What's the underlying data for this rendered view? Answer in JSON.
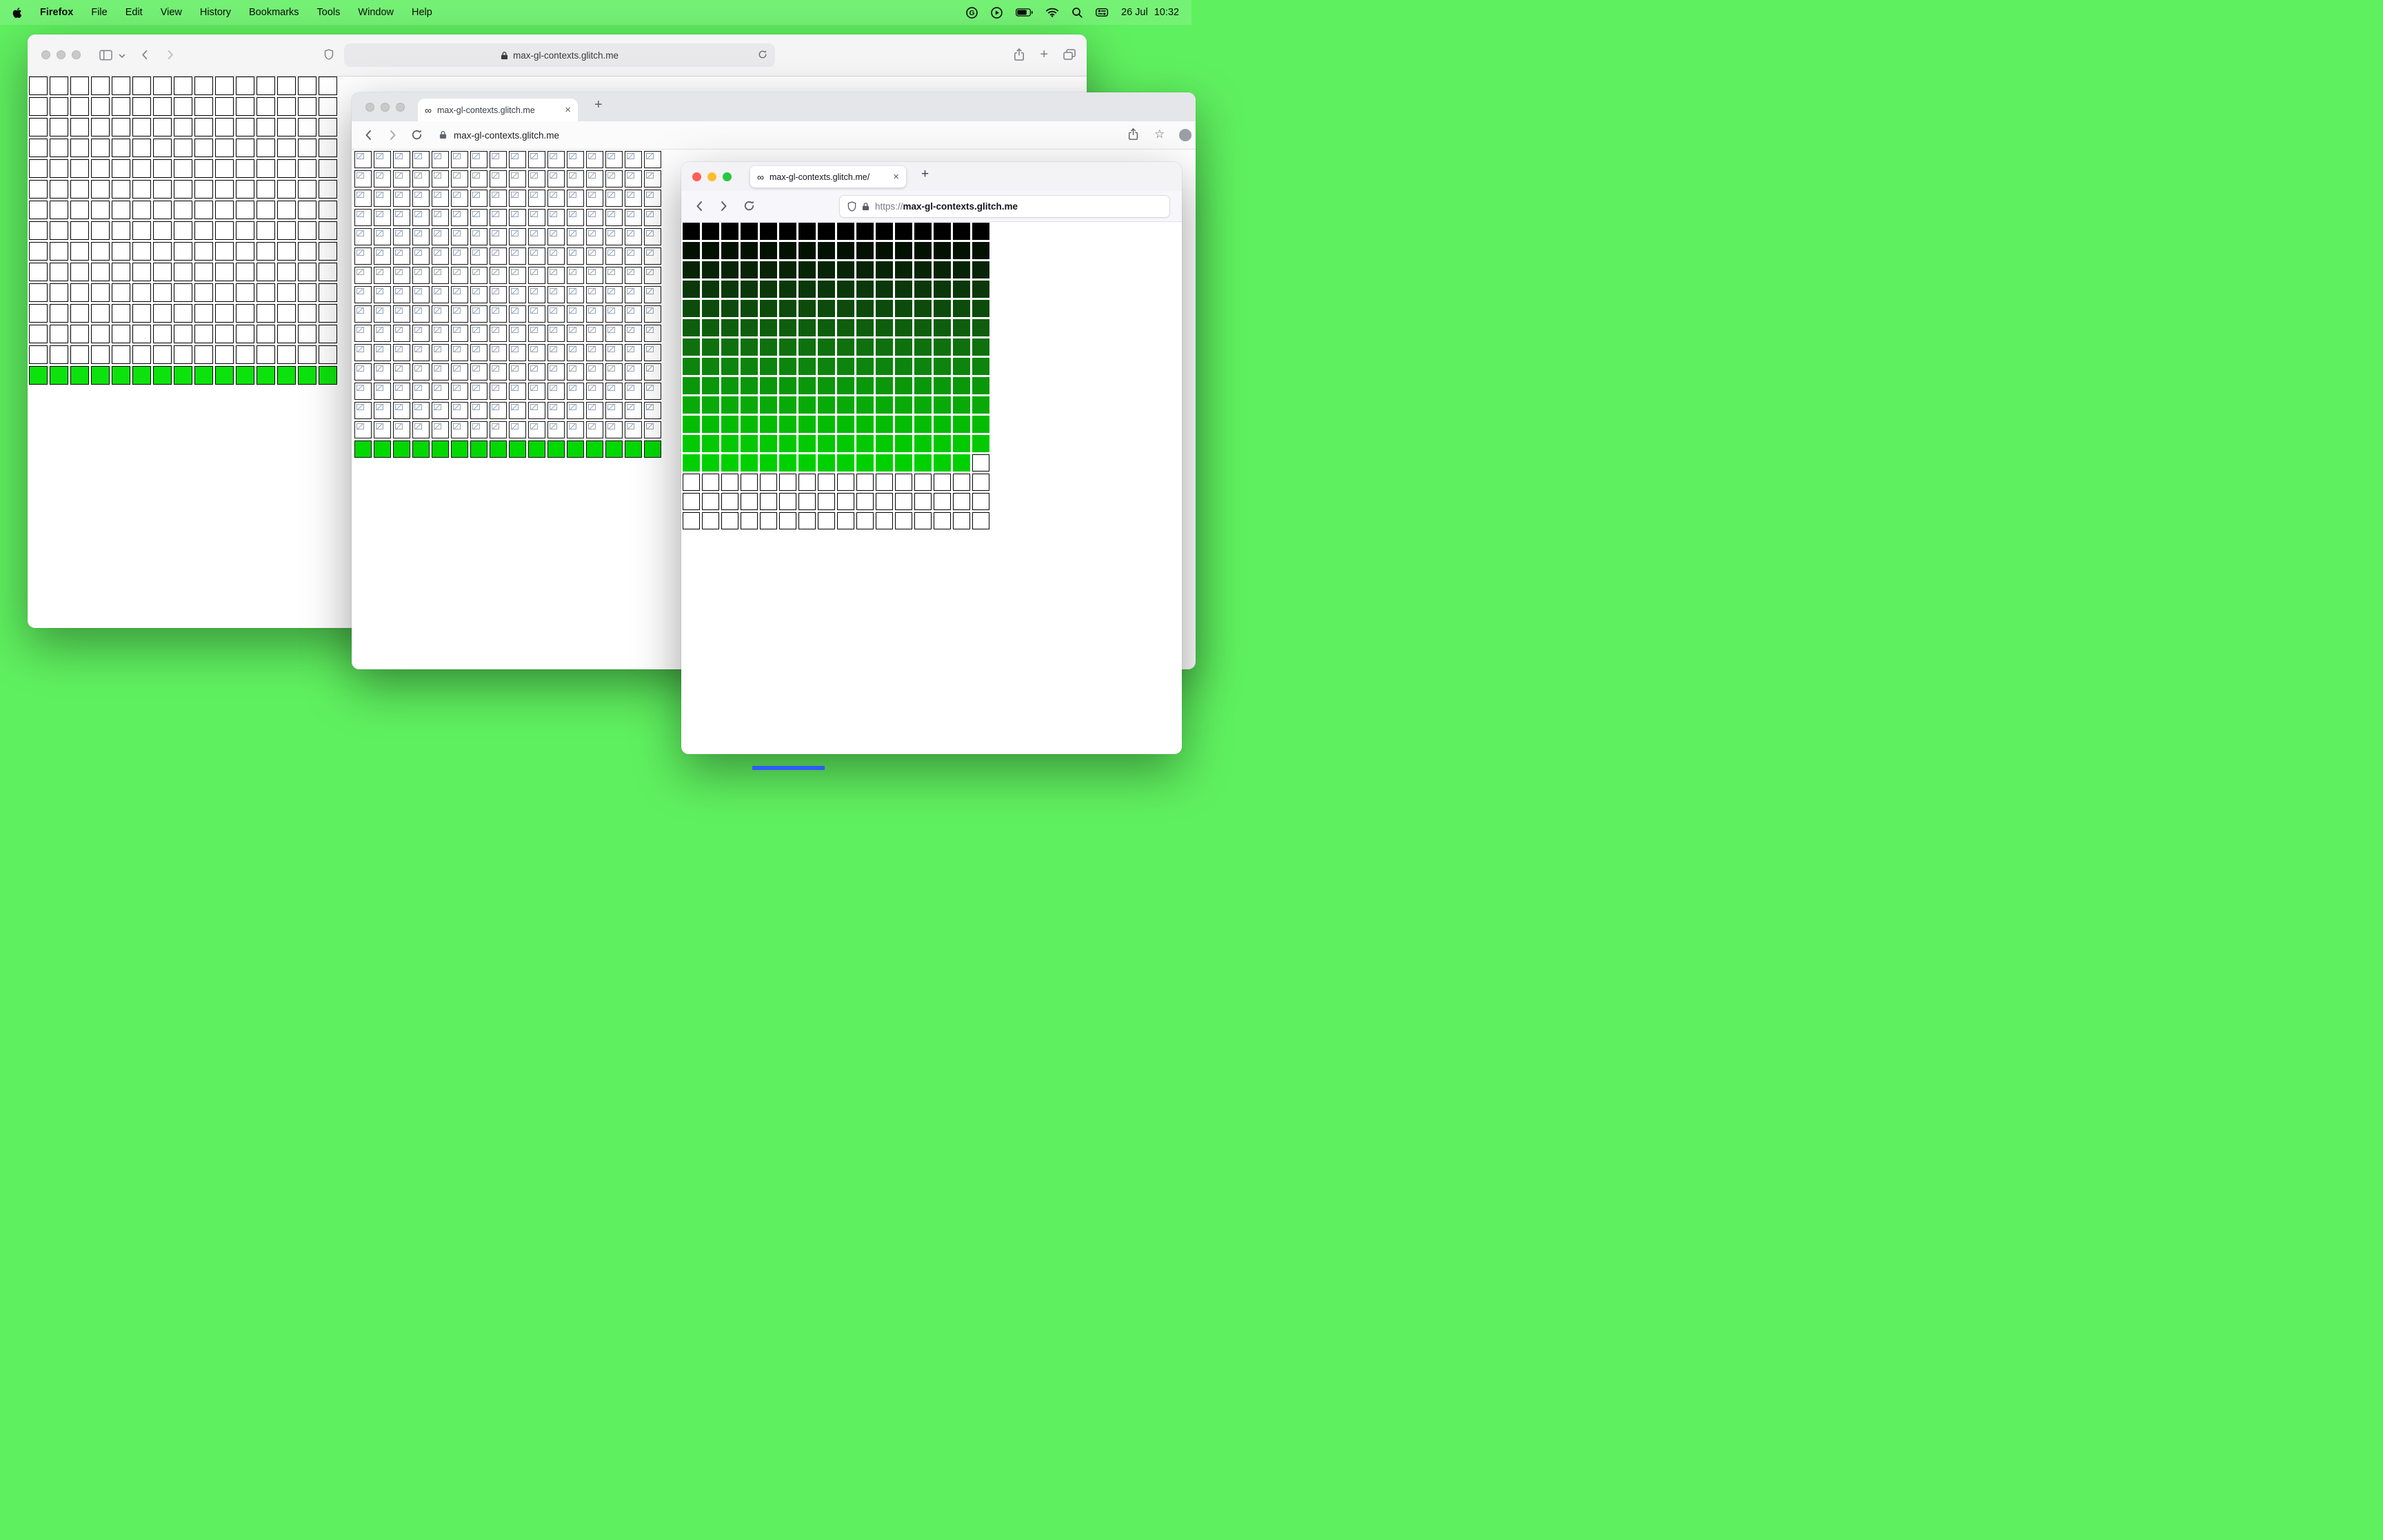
{
  "menubar": {
    "app_name": "Firefox",
    "menus": [
      "File",
      "Edit",
      "View",
      "History",
      "Bookmarks",
      "Tools",
      "Window",
      "Help"
    ],
    "date": "26 Jul",
    "time": "10:32"
  },
  "glyphs": {
    "infinity": "∞",
    "close": "×",
    "plus": "+",
    "star": "☆"
  },
  "safari": {
    "url": "max-gl-contexts.glitch.me",
    "grid": {
      "cols": 15,
      "cell": 27,
      "gap": 3,
      "rows": [
        {
          "repeat": 14,
          "color": "#ffffff",
          "border": "#000000"
        },
        {
          "color": "#0ce30c",
          "border": "#000000"
        }
      ]
    }
  },
  "chrome": {
    "tab_title": "max-gl-contexts.glitch.me",
    "url": "max-gl-contexts.glitch.me",
    "grid": {
      "cols": 16,
      "cell": 25,
      "gap": 3,
      "rows": [
        {
          "repeat": 15,
          "color": "#ffffff",
          "border": "#141414",
          "broken_icon": true
        },
        {
          "color": "#00d800",
          "border": "#0a0a0a"
        }
      ]
    }
  },
  "firefox": {
    "tab_title": "max-gl-contexts.glitch.me/",
    "url_scheme": "https://",
    "url_host": "max-gl-contexts.glitch.me",
    "grid": {
      "cols": 16,
      "cell": 25,
      "gap": 3,
      "rows": [
        {
          "color": "#000000"
        },
        {
          "color": "#031103"
        },
        {
          "color": "#072407"
        },
        {
          "color": "#0a380a"
        },
        {
          "color": "#0c4b0c"
        },
        {
          "color": "#0e5e0e"
        },
        {
          "color": "#0e710e"
        },
        {
          "color": "#0d840d"
        },
        {
          "color": "#0a970a"
        },
        {
          "color": "#07aa07"
        },
        {
          "color": "#04bc04"
        },
        {
          "color": "#02c902"
        },
        {
          "color": "#00d000",
          "white_last": true,
          "white_border": "#000000"
        },
        {
          "repeat": 3,
          "color": "#ffffff",
          "border": "#000000"
        }
      ]
    }
  },
  "colors": {
    "desktop": "#5ff05f",
    "blue_strip": "#2f5bf7"
  }
}
